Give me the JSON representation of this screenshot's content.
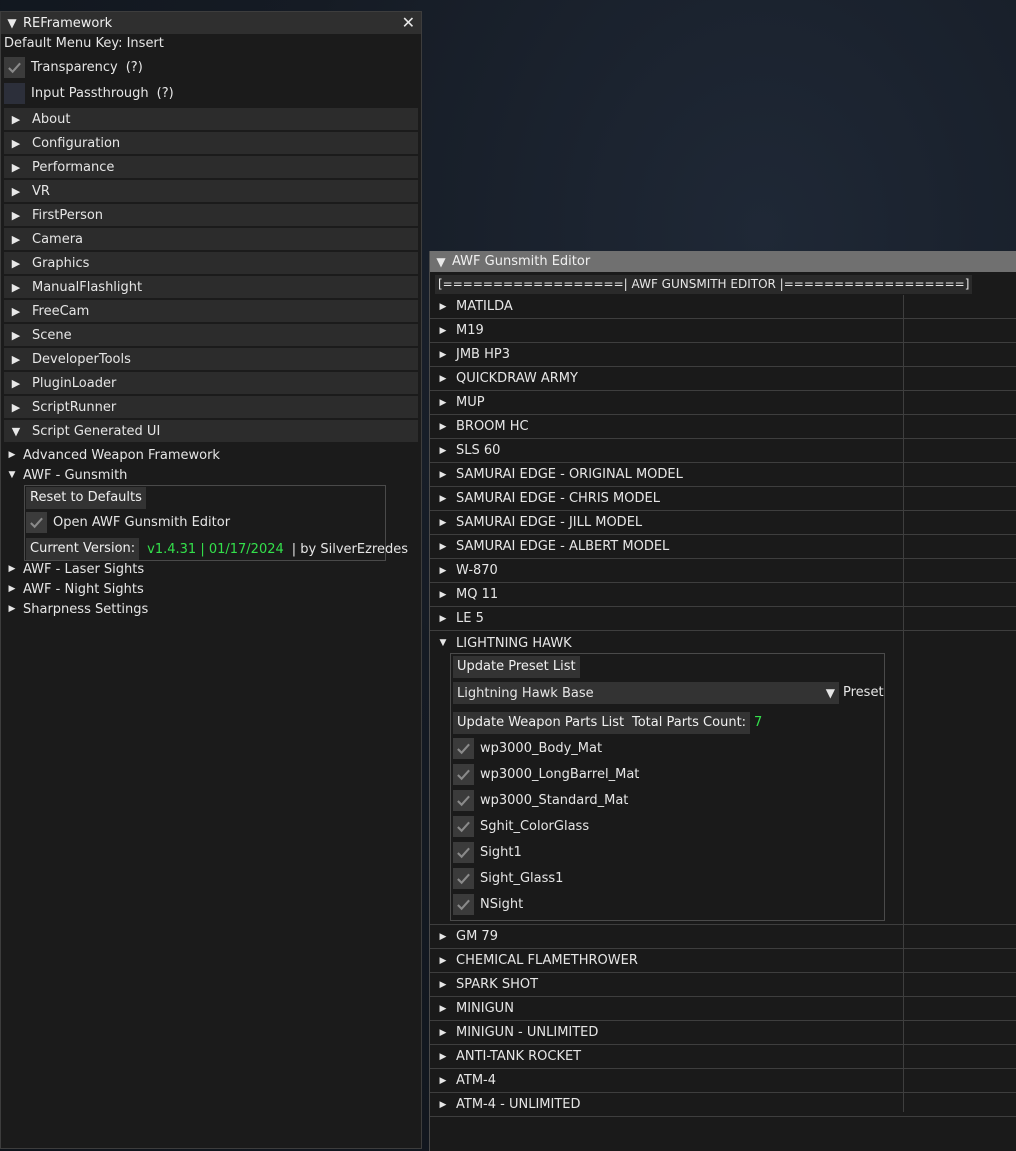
{
  "reframework": {
    "title": "REFramework",
    "menu_key": "Default Menu Key: Insert",
    "transparency": {
      "label": "Transparency",
      "help": "(?)",
      "checked": true
    },
    "passthrough": {
      "label": "Input Passthrough",
      "help": "(?)",
      "checked": false
    },
    "sections": [
      "About",
      "Configuration",
      "Performance",
      "VR",
      "FirstPerson",
      "Camera",
      "Graphics",
      "ManualFlashlight",
      "FreeCam",
      "Scene",
      "DeveloperTools",
      "PluginLoader",
      "ScriptRunner"
    ],
    "script_ui": {
      "label": "Script Generated UI",
      "items": [
        "Advanced Weapon Framework",
        "AWF - Gunsmith"
      ],
      "items_after": [
        "AWF - Laser Sights",
        "AWF - Night Sights",
        "Sharpness Settings"
      ],
      "gunsmith": {
        "reset_label": "Reset to Defaults",
        "open_editor_label": "Open AWF Gunsmith Editor",
        "version_label": "Current Version:",
        "version_value": "v1.4.31 | 01/17/2024",
        "author": "| by SilverEzredes"
      }
    }
  },
  "awf_editor": {
    "title": "AWF Gunsmith Editor",
    "banner": "[==================| AWF GUNSMITH EDITOR |==================]",
    "weapons_before": [
      "MATILDA",
      "M19",
      "JMB HP3",
      "QUICKDRAW ARMY",
      "MUP",
      "BROOM HC",
      "SLS 60",
      "SAMURAI EDGE - ORIGINAL MODEL",
      "SAMURAI EDGE - CHRIS MODEL",
      "SAMURAI EDGE - JILL MODEL",
      "SAMURAI EDGE - ALBERT MODEL",
      "W-870",
      "MQ 11",
      "LE 5"
    ],
    "expanded_weapon": {
      "name": "LIGHTNING HAWK",
      "update_preset_label": "Update Preset List",
      "preset_value": "Lightning Hawk Base",
      "preset_label": "Preset",
      "update_parts_label": "Update Weapon Parts List",
      "total_parts_label": "Total Parts Count:",
      "total_parts_value": "7",
      "parts": [
        "wp3000_Body_Mat",
        "wp3000_LongBarrel_Mat",
        "wp3000_Standard_Mat",
        "Sghit_ColorGlass",
        "Sight1",
        "Sight_Glass1",
        "NSight"
      ]
    },
    "weapons_after": [
      "GM 79",
      "CHEMICAL FLAMETHROWER",
      "SPARK SHOT",
      "MINIGUN",
      "MINIGUN - UNLIMITED",
      "ANTI-TANK ROCKET",
      "ATM-4",
      "ATM-4 - UNLIMITED"
    ]
  },
  "icons": {
    "expanded": "triangle-down-icon",
    "collapsed": "triangle-right-icon",
    "check": "checkmark-icon",
    "close": "close-x-icon"
  },
  "colors": {
    "accent_green": "#33e04b",
    "window_bg": "#1b1b1b",
    "header_bg": "#2c2c2c",
    "awf_title_bg": "#707070"
  }
}
